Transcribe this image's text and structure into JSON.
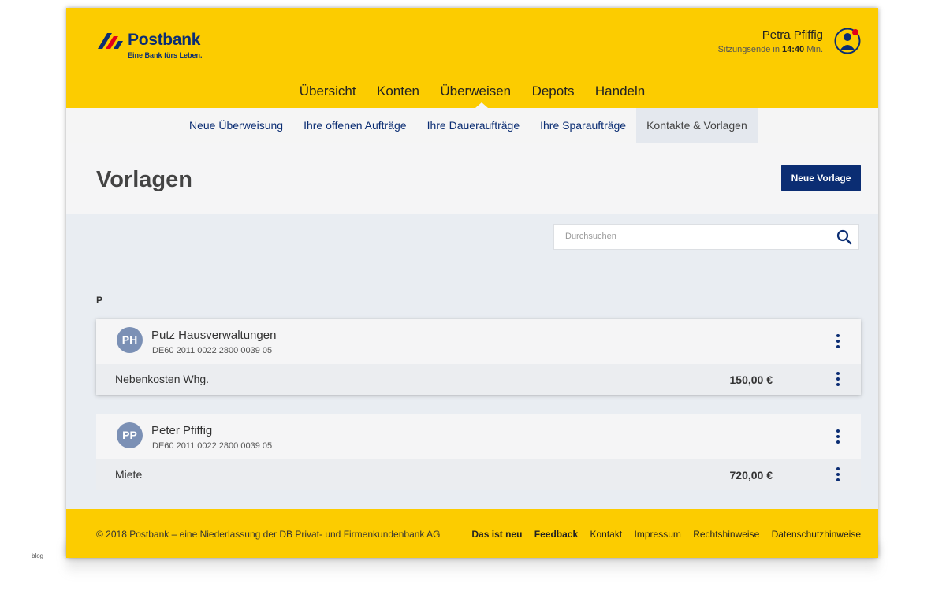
{
  "brand": {
    "name": "Postbank",
    "tagline": "Eine Bank fürs Leben.",
    "colors": {
      "yellow": "#fccc00",
      "navy": "#0b2d73"
    }
  },
  "user": {
    "name": "Petra Pfiffig",
    "session_prefix": "Sitzungsende in",
    "session_time": "14:40",
    "session_suffix": "Min."
  },
  "main_nav": [
    "Übersicht",
    "Konten",
    "Überweisen",
    "Depots",
    "Handeln"
  ],
  "main_nav_active": "Überweisen",
  "sub_nav": [
    "Neue Überweisung",
    "Ihre offenen Aufträge",
    "Ihre Daueraufträge",
    "Ihre Sparaufträge",
    "Kontakte & Vorlagen"
  ],
  "sub_nav_active": "Kontakte & Vorlagen",
  "page": {
    "title": "Vorlagen",
    "new_button": "Neue Vorlage"
  },
  "search": {
    "placeholder": "Durchsuchen",
    "value": ""
  },
  "group_letter": "P",
  "templates": [
    {
      "initials": "PH",
      "name": "Putz Hausverwaltungen",
      "iban": "DE60 2011 0022 2800 0039 05",
      "purpose": "Nebenkosten Whg.",
      "amount": "150,00 €"
    },
    {
      "initials": "PP",
      "name": "Peter Pfiffig",
      "iban": "DE60 2011 0022 2800 0039 05",
      "purpose": "Miete",
      "amount": "720,00 €"
    }
  ],
  "footer": {
    "copyright": "© 2018 Postbank – eine Niederlassung der DB Privat- und Firmenkundenbank AG",
    "links": [
      "Das ist neu",
      "Feedback",
      "Kontakt",
      "Impressum",
      "Rechtshinweise",
      "Datenschutzhinweise"
    ]
  },
  "watermark": "blog"
}
